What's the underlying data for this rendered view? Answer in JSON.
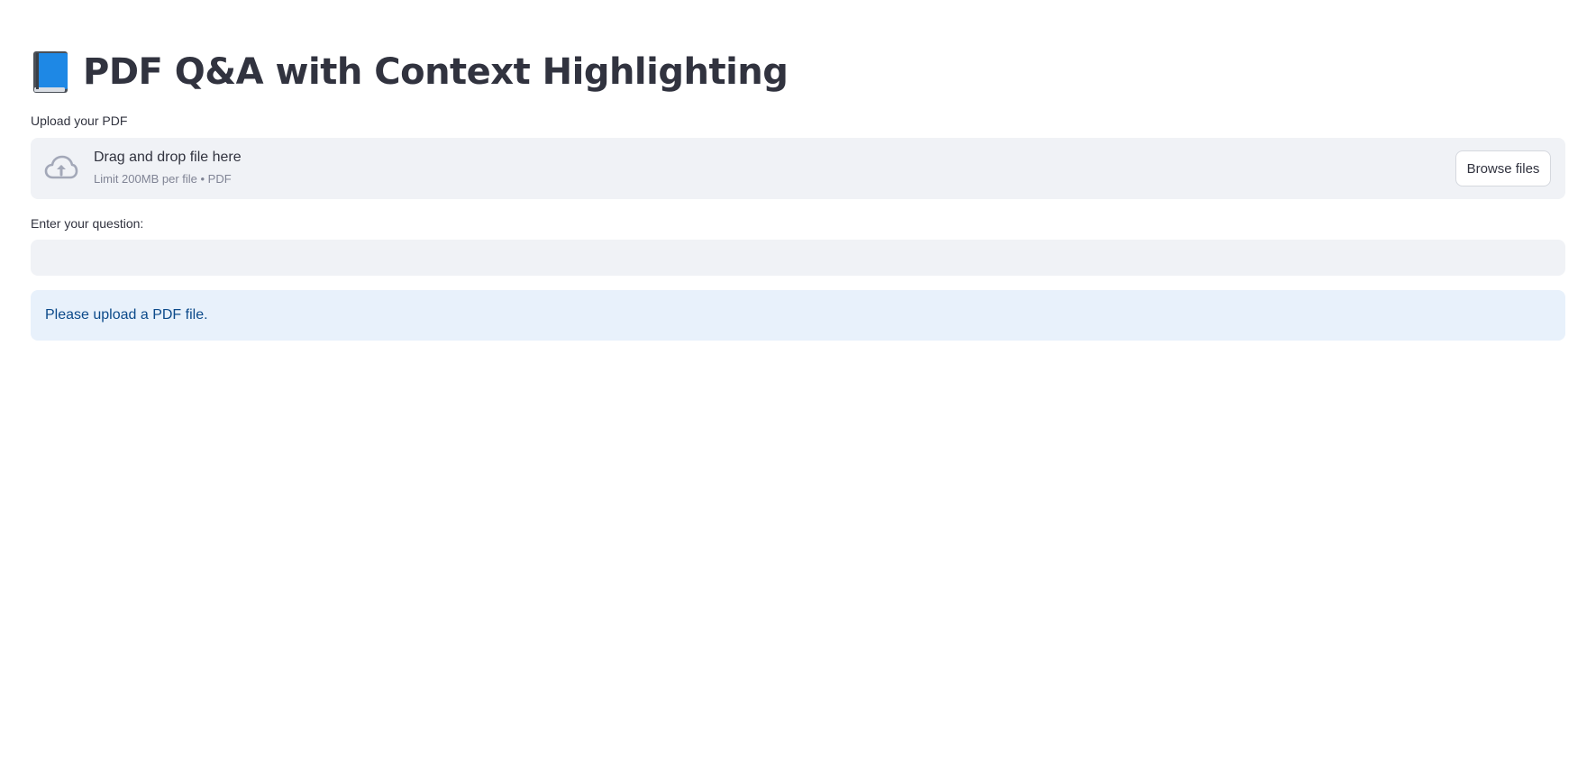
{
  "header": {
    "icon": "blue-book-icon",
    "title": "PDF Q&A with Context Highlighting"
  },
  "uploader": {
    "label": "Upload your PDF",
    "icon": "cloud-upload-icon",
    "drop_text": "Drag and drop file here",
    "limit_text": "Limit 200MB per file • PDF",
    "browse_label": "Browse files"
  },
  "question": {
    "label": "Enter your question:",
    "value": "",
    "placeholder": ""
  },
  "info": {
    "message": "Please upload a PDF file."
  },
  "colors": {
    "text": "#31333f",
    "input_bg": "#f0f2f6",
    "info_bg": "#e8f1fb",
    "info_text": "#0c4a8a",
    "book_blue": "#1e88e5"
  }
}
